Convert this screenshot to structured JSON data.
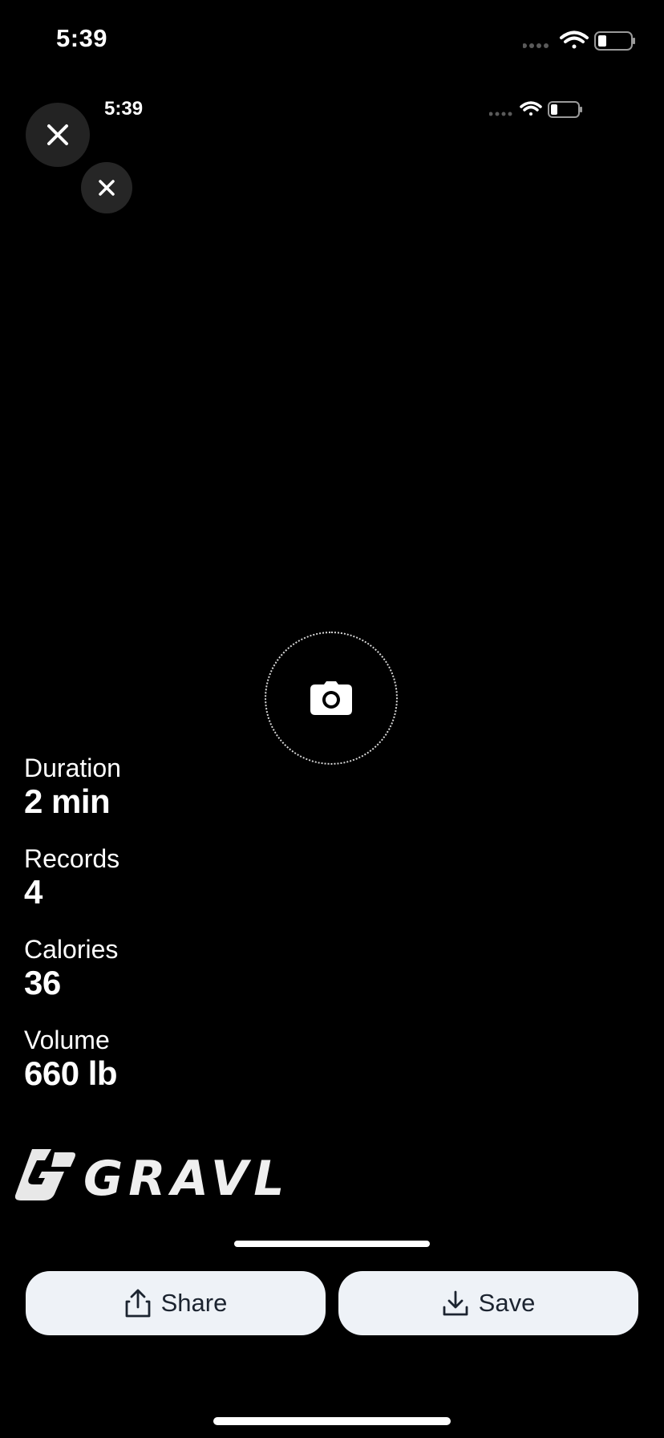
{
  "status_bar": {
    "time": "5:39",
    "inner_time": "5:39"
  },
  "stats": [
    {
      "label": "Duration",
      "value": "2 min"
    },
    {
      "label": "Records",
      "value": "4"
    },
    {
      "label": "Calories",
      "value": "36"
    },
    {
      "label": "Volume",
      "value": "660 lb"
    }
  ],
  "brand": {
    "name": "GRAVL"
  },
  "actions": {
    "share_label": "Share",
    "save_label": "Save"
  },
  "icons": {
    "close": "close-icon",
    "camera": "camera-icon",
    "share": "share-icon",
    "save": "download-icon",
    "wifi": "wifi-icon",
    "battery": "battery-icon",
    "signal": "signal-icon"
  },
  "colors": {
    "background": "#000000",
    "button_bg": "#eef2f7",
    "button_text": "#1c2430",
    "close_bg": "#232323"
  }
}
